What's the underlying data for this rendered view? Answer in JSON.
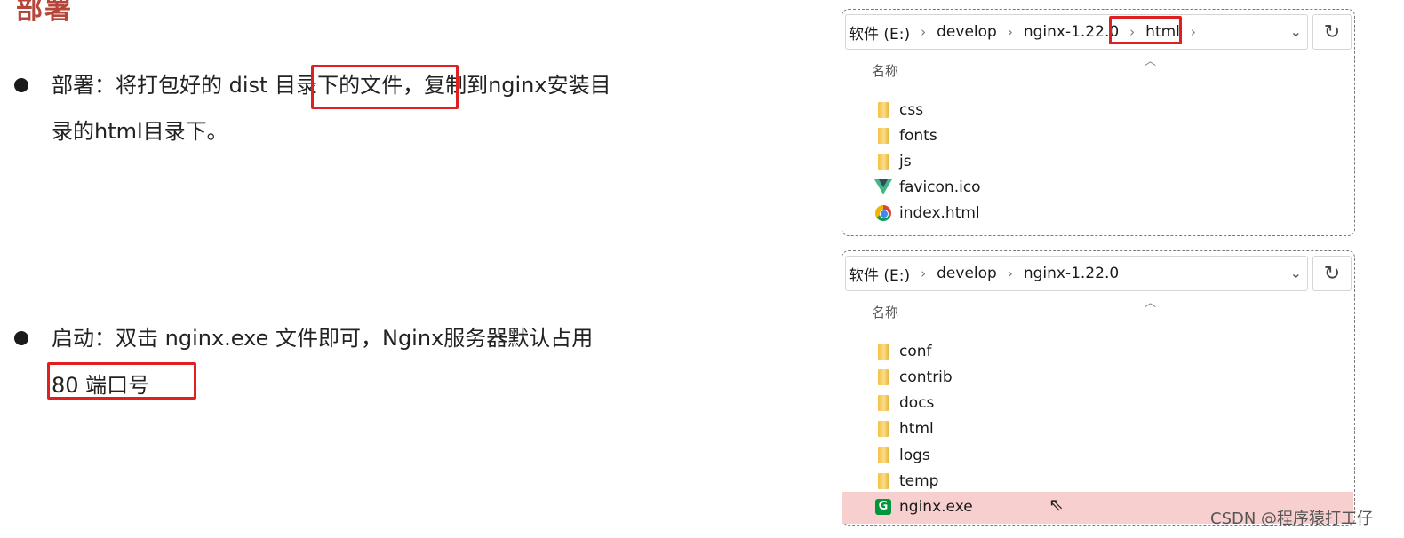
{
  "slide": {
    "heading": "部署",
    "bullets": [
      {
        "line1": "部署：将打包好的 dist 目录下的文件，复制到nginx安装目",
        "line2": "录的html目录下。"
      },
      {
        "line1": "启动：双击 nginx.exe 文件即可，Nginx服务器默认占用",
        "line2": "80 端口号"
      }
    ]
  },
  "explorer_top": {
    "breadcrumb": [
      "软件 (E:)",
      "develop",
      "nginx-1.22.0",
      "html"
    ],
    "column_header": "名称",
    "items": [
      {
        "name": "css",
        "icon": "folder-icon"
      },
      {
        "name": "fonts",
        "icon": "folder-icon"
      },
      {
        "name": "js",
        "icon": "folder-icon"
      },
      {
        "name": "favicon.ico",
        "icon": "vue-logo-icon"
      },
      {
        "name": "index.html",
        "icon": "chrome-icon"
      }
    ]
  },
  "explorer_bottom": {
    "breadcrumb": [
      "软件 (E:)",
      "develop",
      "nginx-1.22.0"
    ],
    "column_header": "名称",
    "items": [
      {
        "name": "conf",
        "icon": "folder-icon"
      },
      {
        "name": "contrib",
        "icon": "folder-icon"
      },
      {
        "name": "docs",
        "icon": "folder-icon"
      },
      {
        "name": "html",
        "icon": "folder-icon"
      },
      {
        "name": "logs",
        "icon": "folder-icon"
      },
      {
        "name": "temp",
        "icon": "folder-icon"
      },
      {
        "name": "nginx.exe",
        "icon": "nginx-app-icon"
      }
    ],
    "selected_item": "nginx.exe"
  },
  "watermark": "CSDN @程序猿打工仔",
  "colors": {
    "heading": "#b5473a",
    "highlight_box": "#e02020",
    "selected_row": "#f8cfcf"
  }
}
